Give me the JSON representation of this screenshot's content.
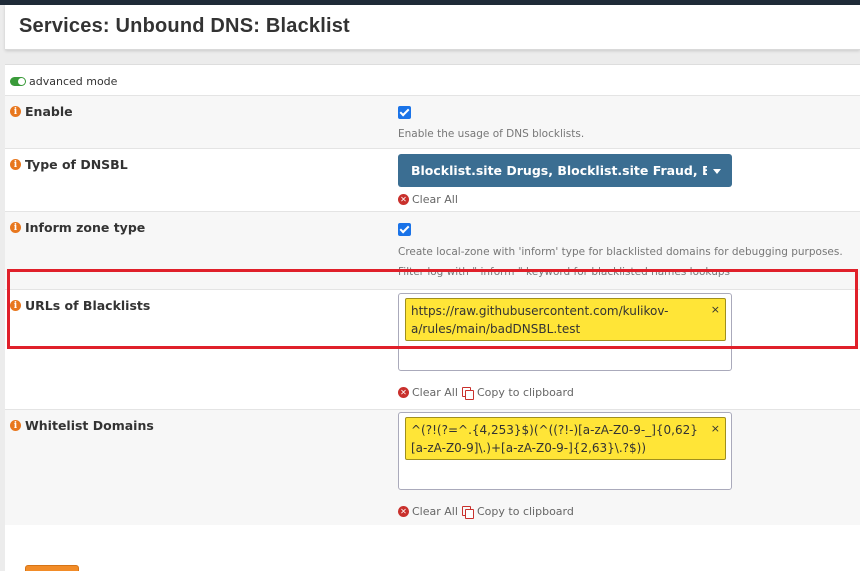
{
  "header": {
    "title": "Services: Unbound DNS: Blacklist"
  },
  "advanced_mode": {
    "label": "advanced mode"
  },
  "rows": {
    "enable": {
      "label": "Enable",
      "help": "Enable the usage of DNS blocklists."
    },
    "type_of_dnsbl": {
      "label": "Type of DNSBL",
      "selected": "Blocklist.site Drugs, Blocklist.site Fraud, Blocklist.site Gambling, Blocklist.site Malware",
      "clear_all": "Clear All"
    },
    "inform_zone_type": {
      "label": "Inform zone type",
      "help_line1": "Create local-zone with 'inform' type for blacklisted domains for debugging purposes.",
      "help_line2": "Filter log with \" inform \" keyword for blacklisted names lookups"
    },
    "urls_of_blacklists": {
      "label": "URLs of Blacklists",
      "tag": "https://raw.githubusercontent.com/kulikov-a/rules/main/badDNSBL.test",
      "clear_all": "Clear All",
      "copy": "Copy to clipboard"
    },
    "whitelist_domains": {
      "label": "Whitelist Domains",
      "tag": "^(?!(?=^.{4,253}$)(^((?!-)[a-zA-Z0-9-_]{0,62}[a-zA-Z0-9]\\.)+[a-zA-Z0-9-]{2,63}\\.?$))",
      "clear_all": "Clear All",
      "copy": "Copy to clipboard"
    }
  },
  "icons": {
    "info": "info-icon",
    "clear": "x-circle-icon",
    "copy": "copy-icon",
    "tag_close": "close-icon"
  },
  "colors": {
    "accent_select": "#3b6e92",
    "tag_bg": "#ffe537",
    "info_icon": "#e8771e",
    "clear_icon": "#c9302c",
    "highlight_box": "#e0202a",
    "checkbox": "#1a73e8"
  }
}
